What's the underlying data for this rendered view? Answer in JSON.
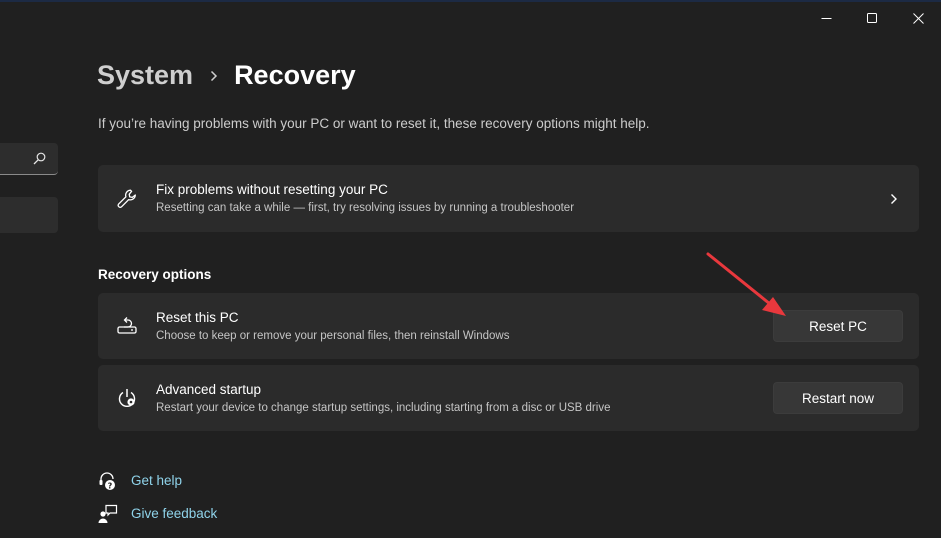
{
  "window": {
    "controls": {
      "minimize": "minimize",
      "maximize": "maximize",
      "close": "close"
    }
  },
  "sidebar": {
    "search_icon": "search-icon"
  },
  "header": {
    "breadcrumb_parent": "System",
    "breadcrumb_separator": "›",
    "breadcrumb_current": "Recovery",
    "subtitle": "If you’re having problems with your PC or want to reset it, these recovery options might help."
  },
  "fix_card": {
    "icon": "wrench-icon",
    "title": "Fix problems without resetting your PC",
    "description": "Resetting can take a while — first, try resolving issues by running a troubleshooter",
    "chevron": "chevron-right-icon"
  },
  "recovery_options": {
    "label": "Recovery options",
    "items": [
      {
        "icon": "reset-pc-icon",
        "title": "Reset this PC",
        "description": "Choose to keep or remove your personal files, then reinstall Windows",
        "button_label": "Reset PC"
      },
      {
        "icon": "advanced-startup-icon",
        "title": "Advanced startup",
        "description": "Restart your device to change startup settings, including starting from a disc or USB drive",
        "button_label": "Restart now"
      }
    ]
  },
  "help_links": [
    {
      "icon": "get-help-icon",
      "label": "Get help"
    },
    {
      "icon": "give-feedback-icon",
      "label": "Give feedback"
    }
  ],
  "annotation": {
    "arrow_color": "#e8383d",
    "target": "Reset PC"
  },
  "colors": {
    "background": "#202020",
    "card": "#2b2b2b",
    "button": "#373737",
    "link": "#8fd3ea"
  }
}
